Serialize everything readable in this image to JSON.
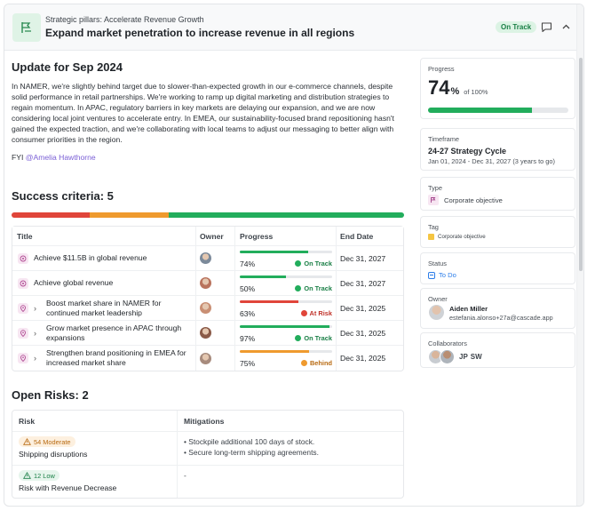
{
  "header": {
    "subtitle": "Strategic pillars: Accelerate Revenue Growth",
    "title": "Expand market penetration to increase revenue in all regions",
    "status": "On Track"
  },
  "update": {
    "heading": "Update for Sep 2024",
    "body": "In NAMER, we're slightly behind target due to slower-than-expected growth in our e-commerce channels, despite solid performance in retail partnerships. We're working to ramp up digital marketing and distribution strategies to regain momentum. In APAC, regulatory barriers in key markets are delaying our expansion, and we are now considering local joint ventures to accelerate entry. In EMEA, our sustainability-focused brand repositioning hasn't gained the expected traction, and we're collaborating with local teams to adjust our messaging to better align with consumer priorities in the region.",
    "fyi_prefix": "FYI",
    "mention": "@Amelia Hawthorne"
  },
  "success": {
    "heading": "Success criteria: 5",
    "bar": [
      {
        "fraction": 0.2,
        "color": "#e0453a"
      },
      {
        "fraction": 0.2,
        "color": "#ef9a2e"
      },
      {
        "fraction": 0.6,
        "color": "#22ad5c"
      }
    ],
    "columns": {
      "title": "Title",
      "owner": "Owner",
      "progress": "Progress",
      "end": "End Date"
    },
    "rows": [
      {
        "title": "Achieve $11.5B in global revenue",
        "expand": false,
        "icon": "target-icon",
        "owner": "#7c8a9a",
        "progress": 0.74,
        "pct": "74%",
        "status": "On Track",
        "status_color": "#22ad5c",
        "bar_color": "#22ad5c",
        "end": "Dec 31, 2027"
      },
      {
        "title": "Achieve global revenue",
        "expand": false,
        "icon": "target-icon",
        "owner": "#b9735d",
        "progress": 0.5,
        "pct": "50%",
        "status": "On Track",
        "status_color": "#22ad5c",
        "bar_color": "#22ad5c",
        "end": "Dec 31, 2027"
      },
      {
        "title": "Boost market share in NAMER for continued market leadership",
        "expand": true,
        "icon": "pin-icon",
        "owner": "#c98f74",
        "progress": 0.63,
        "pct": "63%",
        "status": "At Risk",
        "status_color": "#e0453a",
        "bar_color": "#e0453a",
        "end": "Dec 31, 2025"
      },
      {
        "title": "Grow market presence in APAC through expansions",
        "expand": true,
        "icon": "pin-icon",
        "owner": "#8a5a48",
        "progress": 0.97,
        "pct": "97%",
        "status": "On Track",
        "status_color": "#22ad5c",
        "bar_color": "#22ad5c",
        "end": "Dec 31, 2025"
      },
      {
        "title": "Strengthen brand positioning in EMEA for increased market share",
        "expand": true,
        "icon": "pin-icon",
        "owner": "#a78b7d",
        "progress": 0.75,
        "pct": "75%",
        "status": "Behind",
        "status_color": "#ef9a2e",
        "bar_color": "#ef9a2e",
        "end": "Dec 31, 2025"
      }
    ]
  },
  "risks": {
    "heading": "Open Risks: 2",
    "columns": {
      "risk": "Risk",
      "mitigations": "Mitigations"
    },
    "rows": [
      {
        "severity": "54 Moderate",
        "level": "mod",
        "name": "Shipping disruptions",
        "mitigations": [
          "Stockpile additional 100 days of stock.",
          "Secure long-term shipping agreements."
        ]
      },
      {
        "severity": "12 Low",
        "level": "low",
        "name": "Risk with Revenue Decrease",
        "mitigations": [
          "-"
        ]
      }
    ]
  },
  "sidebar": {
    "progress_label": "Progress",
    "progress_value": "74",
    "progress_unit": "%",
    "progress_of": "of 100%",
    "progress_fraction": 0.74,
    "timeframe_label": "Timeframe",
    "timeframe_name": "24-27 Strategy Cycle",
    "timeframe_dates": "Jan 01, 2024 - Dec 31, 2027 (3 years to go)",
    "type_label": "Type",
    "type_value": "Corporate objective",
    "tag_label": "Tag",
    "tag_value": "Corporate objective",
    "status_label": "Status",
    "status_value": "To Do",
    "owner_label": "Owner",
    "owner_name": "Aiden Miller",
    "owner_email": "estefania.alonso+27a@cascade.app",
    "collab_label": "Collaborators",
    "collab_initials": [
      "JP",
      "SW"
    ]
  },
  "colors": {
    "accent": "#22ad5c",
    "mention": "#7a5fd6",
    "link": "#2b7de9"
  }
}
